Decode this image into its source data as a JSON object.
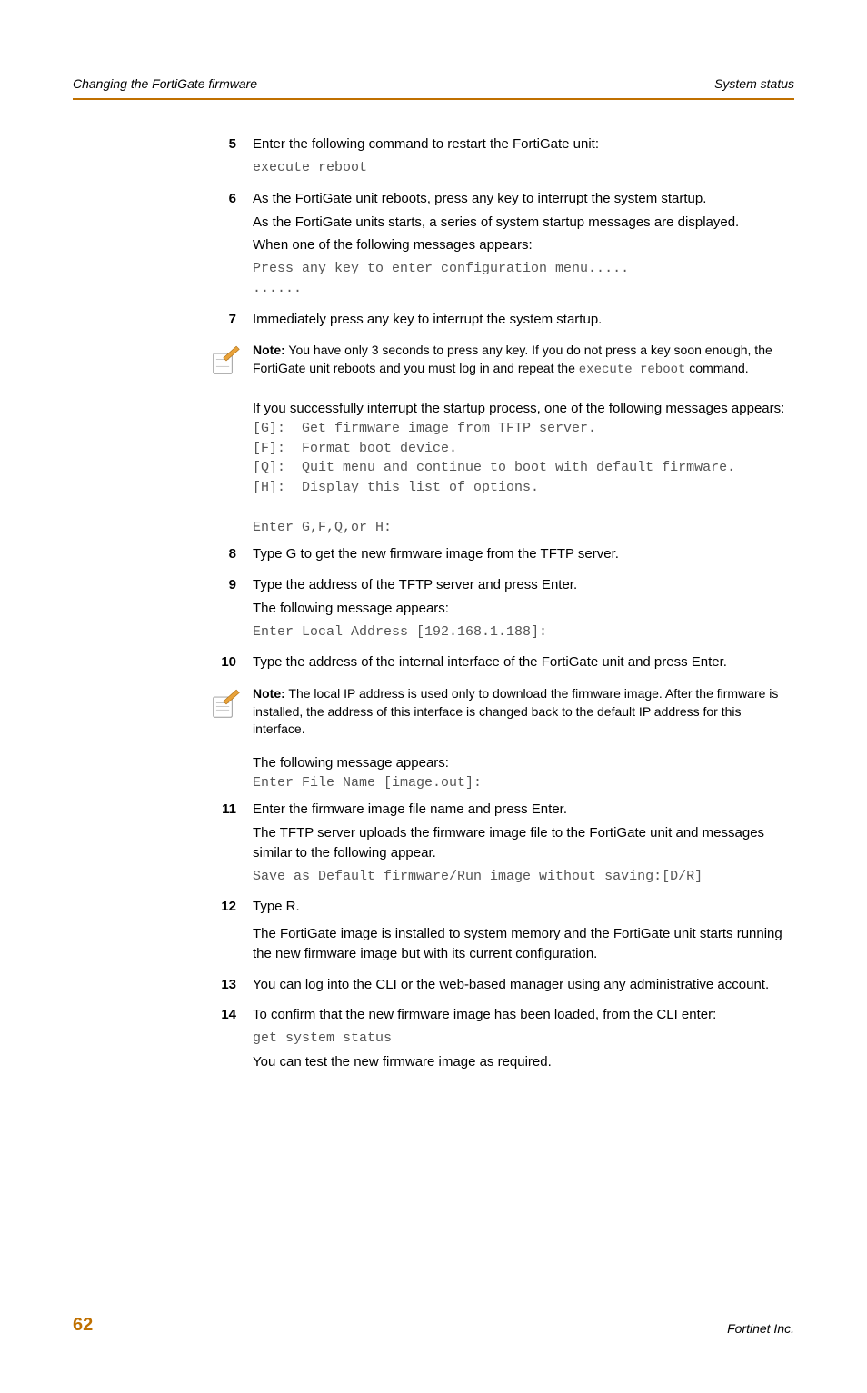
{
  "header": {
    "left": "Changing the FortiGate firmware",
    "right": "System status"
  },
  "steps": {
    "s5": {
      "num": "5",
      "p1": "Enter the following command to restart the FortiGate unit:",
      "code": "execute reboot"
    },
    "s6": {
      "num": "6",
      "p1": "As the FortiGate unit reboots, press any key to interrupt the system startup.",
      "p2": "As the FortiGate units starts, a series of system startup messages are displayed.",
      "p3": "When one of the following messages appears:",
      "code": "Press any key to enter configuration menu.....\n......"
    },
    "s7": {
      "num": "7",
      "p1": "Immediately press any key to interrupt the system startup."
    },
    "s8": {
      "num": "8",
      "p1": "Type G to get the new firmware image from the TFTP server."
    },
    "s9": {
      "num": "9",
      "p1": "Type the address of the TFTP server and press Enter.",
      "p2": "The following message appears:",
      "code": "Enter Local Address [192.168.1.188]:"
    },
    "s10": {
      "num": "10",
      "p1": "Type the address of the internal interface of the FortiGate unit and press Enter."
    },
    "s11": {
      "num": "11",
      "p1": "Enter the firmware image file name and press Enter.",
      "p2": "The TFTP server uploads the firmware image file to the FortiGate unit and messages similar to the following appear.",
      "code": "Save as Default firmware/Run image without saving:[D/R]"
    },
    "s12": {
      "num": "12",
      "p1": "Type R.",
      "p2": "The FortiGate image is installed to system memory and the FortiGate unit starts running the new firmware image but with its current configuration."
    },
    "s13": {
      "num": "13",
      "p1": "You can log into the CLI or the web-based manager using any administrative account."
    },
    "s14": {
      "num": "14",
      "p1": "To confirm that the new firmware image has been loaded, from the CLI enter:",
      "code": "get system status",
      "p2": "You can test the new firmware image as required."
    }
  },
  "note1": {
    "label": "Note:",
    "t1": " You have only 3 seconds to press any key. If you do not press a key soon enough, the FortiGate unit reboots and you must log in and repeat the ",
    "code": "execute reboot",
    "t2": " command."
  },
  "after_note1": {
    "p1": "If you successfully interrupt the startup process, one of the following messages appears:",
    "code": "[G]:  Get firmware image from TFTP server.\n[F]:  Format boot device.\n[Q]:  Quit menu and continue to boot with default firmware.\n[H]:  Display this list of options.\n\nEnter G,F,Q,or H:"
  },
  "note2": {
    "label": "Note:",
    "t1": " The local IP address is used only to download the firmware image. After the firmware is installed, the address of this interface is changed back to the default IP address for this interface."
  },
  "after_note2": {
    "p1": "The following message appears:",
    "code": "Enter File Name [image.out]:"
  },
  "footer": {
    "page": "62",
    "company": "Fortinet Inc."
  }
}
